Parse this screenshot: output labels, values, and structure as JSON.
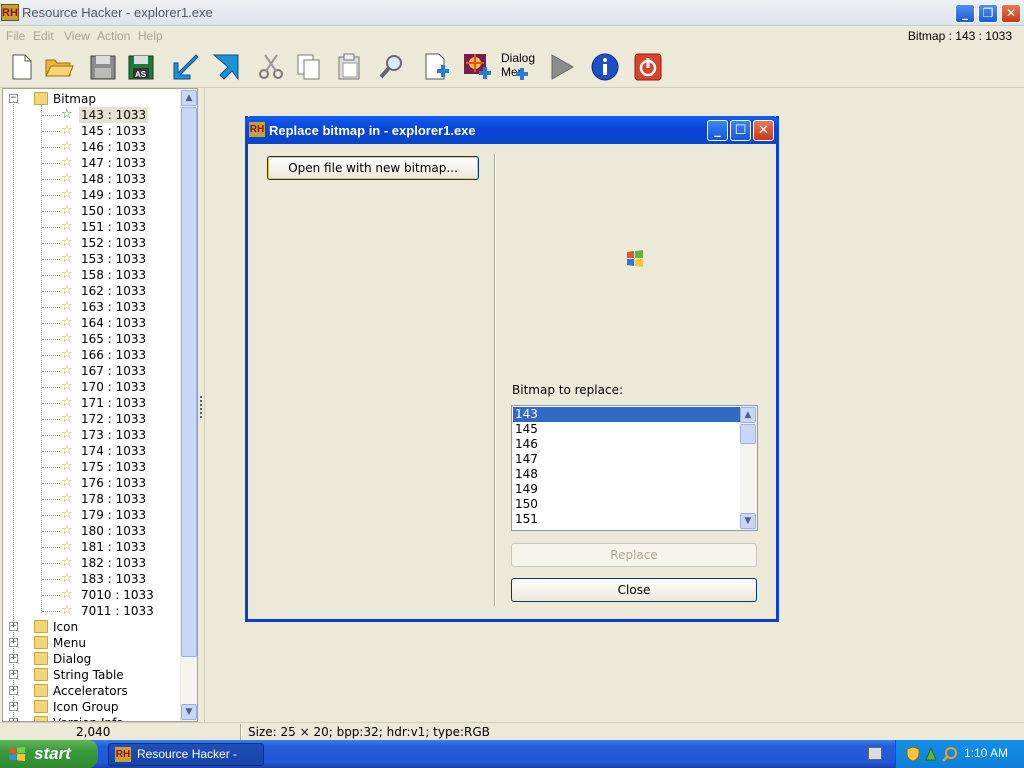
{
  "window": {
    "title": "Resource Hacker - explorer1.exe",
    "app_icon": "RH"
  },
  "menu": {
    "items": [
      "File",
      "Edit",
      "View",
      "Action",
      "Help"
    ],
    "status_right": "Bitmap : 143 : 1033"
  },
  "toolbar": {
    "buttons": [
      "new-file-icon",
      "open-folder-icon",
      "save-icon",
      "save-as-icon",
      "arrow-down-left-icon",
      "arrow-down-right-icon",
      "cut-icon",
      "copy-icon",
      "paste-icon",
      "find-icon",
      "add-resource-icon",
      "replace-bitmap-icon",
      "dialog-menu-icon",
      "run-script-icon",
      "info-icon",
      "exit-icon"
    ],
    "dialog_menu_label_1": "Dialog",
    "dialog_menu_label_2": "Mer"
  },
  "tree": {
    "root": "Bitmap",
    "selected": "143 : 1033",
    "items": [
      "143 : 1033",
      "145 : 1033",
      "146 : 1033",
      "147 : 1033",
      "148 : 1033",
      "149 : 1033",
      "150 : 1033",
      "151 : 1033",
      "152 : 1033",
      "153 : 1033",
      "158 : 1033",
      "162 : 1033",
      "163 : 1033",
      "164 : 1033",
      "165 : 1033",
      "166 : 1033",
      "167 : 1033",
      "170 : 1033",
      "171 : 1033",
      "172 : 1033",
      "173 : 1033",
      "174 : 1033",
      "175 : 1033",
      "176 : 1033",
      "178 : 1033",
      "179 : 1033",
      "180 : 1033",
      "181 : 1033",
      "182 : 1033",
      "183 : 1033",
      "7010 : 1033",
      "7011 : 1033"
    ],
    "folders": [
      "Icon",
      "Menu",
      "Dialog",
      "String Table",
      "Accelerators",
      "Icon Group",
      "Version Info"
    ]
  },
  "dialog": {
    "title": "Replace bitmap in - explorer1.exe",
    "open_button": "Open file with new bitmap...",
    "bitmap_label": "Bitmap to replace:",
    "list": [
      "143",
      "145",
      "146",
      "147",
      "148",
      "149",
      "150",
      "151"
    ],
    "selected": "143",
    "replace_button": "Replace",
    "close_button": "Close"
  },
  "statusbar": {
    "left": "2,040",
    "right": "Size: 25 × 20;  bpp:32;  hdr:v1;  type:RGB"
  },
  "taskbar": {
    "start": "start",
    "task": "Resource Hacker - ex...",
    "clock": "1:10 AM"
  },
  "colors": {
    "selection": "#316ac5",
    "dialog_border": "#0a3fd6",
    "taskbar": "#245edb",
    "start": "#3a9a3a"
  }
}
